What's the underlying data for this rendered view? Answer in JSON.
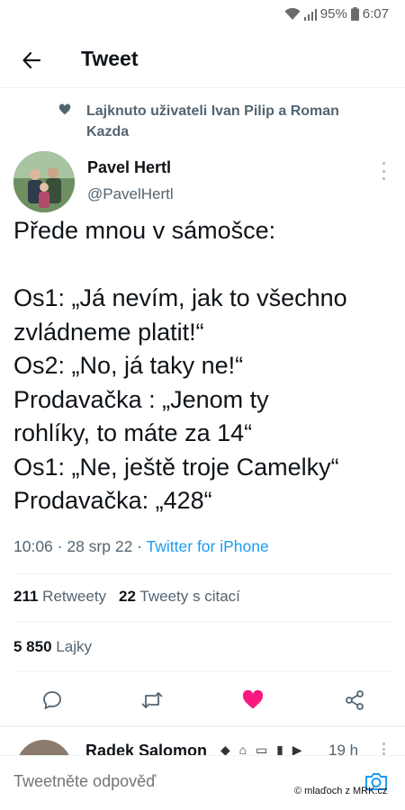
{
  "status_bar": {
    "battery": "95%",
    "time": "6:07"
  },
  "header": {
    "title": "Tweet",
    "back_icon": "arrow-left-icon"
  },
  "social_context": {
    "text": "Lajknuto uživateli Ivan Pilip a Roman Kazda",
    "icon": "heart-icon"
  },
  "tweet": {
    "author_name": "Pavel Hertl",
    "author_handle": "@PavelHertl",
    "lines": [
      "Přede mnou v sámošce:",
      "",
      "Os1: „Já nevím, jak to všechno",
      "zvládneme platit!“",
      "Os2: „No, já taky ne!“",
      "Prodavačka : „Jenom ty",
      "rohlíky, to máte za 14“",
      "Os1: „Ne, ještě troje Camelky“",
      "Prodavačka: „428“"
    ],
    "timestamp": "10:06 · 28 srp 22 · ",
    "source": "Twitter for iPhone"
  },
  "stats": {
    "retweets_count": "211",
    "retweets_label": "Retweety",
    "quotes_count": "22",
    "quotes_label": "Tweety s citací",
    "likes_count": "5 850",
    "likes_label": "Lajky"
  },
  "actions": {
    "reply_icon": "reply-icon",
    "retweet_icon": "retweet-icon",
    "like_icon": "heart-filled-icon",
    "share_icon": "share-icon",
    "like_color": "#f91880"
  },
  "next_tweet": {
    "author_name": "Radek Salomon",
    "time": "19 h"
  },
  "reply_bar": {
    "placeholder": "Tweetněte odpověď",
    "camera_icon": "camera-icon"
  },
  "watermark": "© mlaďoch z MRK.cz"
}
